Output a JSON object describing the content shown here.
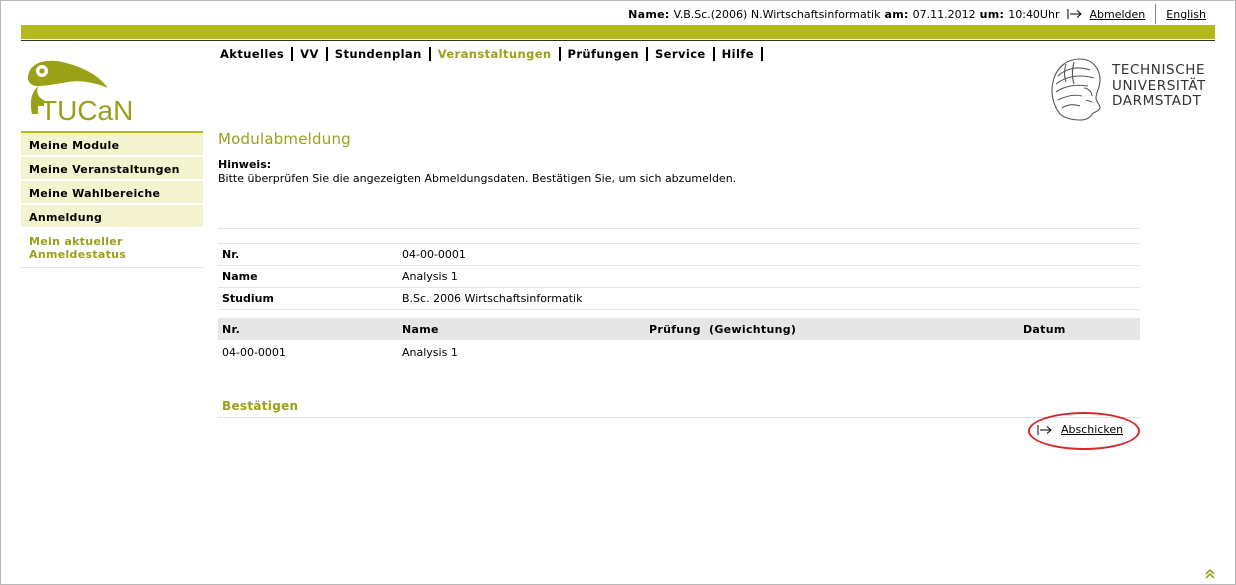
{
  "header": {
    "name_label": "Name:",
    "name_value": "V.B.Sc.(2006) N.Wirtschaftsinformatik",
    "date_label": "am:",
    "date_value": "07.11.2012",
    "time_label": "um:",
    "time_value": "10:40Uhr",
    "logout_label": "Abmelden",
    "language_label": "English"
  },
  "nav": {
    "items": [
      {
        "label": "Aktuelles"
      },
      {
        "label": "VV"
      },
      {
        "label": "Stundenplan"
      },
      {
        "label": "Veranstaltungen",
        "active": true
      },
      {
        "label": "Prüfungen"
      },
      {
        "label": "Service"
      },
      {
        "label": "Hilfe"
      }
    ]
  },
  "logo": {
    "app_name": "TUCaN",
    "university_lines": [
      "TECHNISCHE",
      "UNIVERSITÄT",
      "DARMSTADT"
    ]
  },
  "sidebar": {
    "items": [
      {
        "label": "Meine Module"
      },
      {
        "label": "Meine Veranstaltungen"
      },
      {
        "label": "Meine Wahlbereiche"
      },
      {
        "label": "Anmeldung"
      },
      {
        "label": "Mein aktueller Anmeldestatus",
        "current": true
      }
    ]
  },
  "main": {
    "title": "Modulabmeldung",
    "hint_label": "Hinweis:",
    "hint_text": "Bitte überprüfen Sie die angezeigten Abmeldungsdaten. Bestätigen Sie, um sich abzumelden.",
    "info": [
      {
        "key": "Nr.",
        "value": "04-00-0001"
      },
      {
        "key": "Name",
        "value": "Analysis 1"
      },
      {
        "key": "Studium",
        "value": "B.Sc. 2006 Wirtschaftsinformatik"
      }
    ],
    "table": {
      "headers": [
        "Nr.",
        "Name",
        "Prüfung  (Gewichtung)",
        "Datum"
      ],
      "rows": [
        [
          "04-00-0001",
          "Analysis 1",
          "",
          ""
        ]
      ]
    },
    "confirm_title": "Bestätigen",
    "submit_label": "Abschicken"
  },
  "colors": {
    "accent": "#b4ba1c",
    "accent_text": "#9aa018",
    "sidebar_bg": "#f4f3cf",
    "table_header_bg": "#e6e6e6",
    "highlight_ring": "#d42828"
  },
  "icons": {
    "logout": "arrow-right-icon",
    "submit": "arrow-right-icon",
    "scroll_top": "double-chevron-up-icon"
  }
}
